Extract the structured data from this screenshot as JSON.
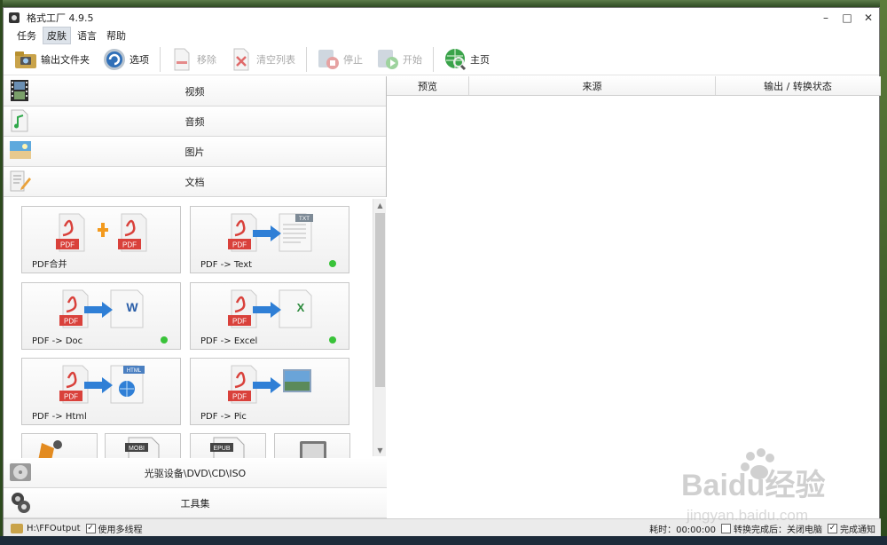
{
  "window": {
    "title": "格式工厂 4.9.5",
    "minimize": "–",
    "maximize": "□",
    "close": "✕"
  },
  "menu": [
    "任务",
    "皮肤",
    "语言",
    "帮助"
  ],
  "toolbar": {
    "output_folder": "输出文件夹",
    "options": "选项",
    "remove": "移除",
    "clear_list": "清空列表",
    "stop": "停止",
    "start": "开始",
    "home": "主页"
  },
  "categories": {
    "video": "视频",
    "audio": "音频",
    "image": "图片",
    "document": "文档",
    "disc": "光驱设备\\DVD\\CD\\ISO",
    "tools": "工具集"
  },
  "tiles": [
    {
      "label": "PDF合并",
      "status": ""
    },
    {
      "label": "PDF -> Text",
      "status": "ready"
    },
    {
      "label": "PDF -> Doc",
      "status": "ready"
    },
    {
      "label": "PDF -> Excel",
      "status": "ready"
    },
    {
      "label": "PDF -> Html",
      "status": ""
    },
    {
      "label": "PDF -> Pic",
      "status": ""
    }
  ],
  "small_tiles": [
    "",
    "MOBI",
    "EPUB",
    ""
  ],
  "table": {
    "columns": [
      "预览",
      "来源",
      "输出 / 转换状态"
    ]
  },
  "status": {
    "output_path": "H:\\FFOutput",
    "multithread": "使用多线程",
    "elapsed": "耗时：00:00:00",
    "after_convert": "转换完成后：关闭电脑",
    "notify": "完成通知"
  },
  "colors": {
    "status_dot": "#39c339",
    "pdf_red": "#d9413b",
    "arrow_blue": "#2f7fd6"
  },
  "watermark": {
    "brand": "Baidu经验",
    "url": "jingyan.baidu.com"
  }
}
